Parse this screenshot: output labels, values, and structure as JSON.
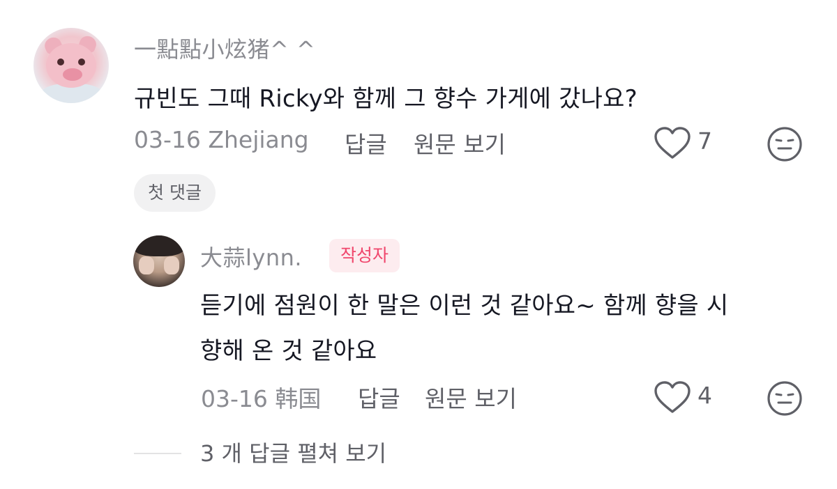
{
  "comment": {
    "username": "一點點小炫猪^ ^",
    "text": "규빈도 그때 Ricky와 함께 그 향수 가게에 갔나요?",
    "date_location": "03-16 Zhejiang",
    "reply_label": "답글",
    "view_original_label": "원문 보기",
    "likes": "7",
    "like_icon": "heart-outline-icon",
    "reaction_icon": "neutral-face-icon",
    "badge": "첫 댓글"
  },
  "reply": {
    "username": "大蒜lynn.",
    "author_badge": "작성자",
    "text_line1": "듣기에 점원이 한 말은 이런 것 같아요~ 함께 향을 시",
    "text_line2": "향해 온 것 같아요",
    "date_location": "03-16 韩国",
    "reply_label": "답글",
    "view_original_label": "원문 보기",
    "likes": "4",
    "like_icon": "heart-outline-icon",
    "reaction_icon": "neutral-face-icon"
  },
  "expand_replies": "3 개 답글 펼쳐 보기",
  "colors": {
    "text_primary": "#161823",
    "text_secondary": "#8a8b91",
    "action": "#5f6067",
    "author_badge_bg": "#fdecef",
    "author_badge_text": "#f0466c",
    "chip_bg": "#f1f1f2"
  }
}
